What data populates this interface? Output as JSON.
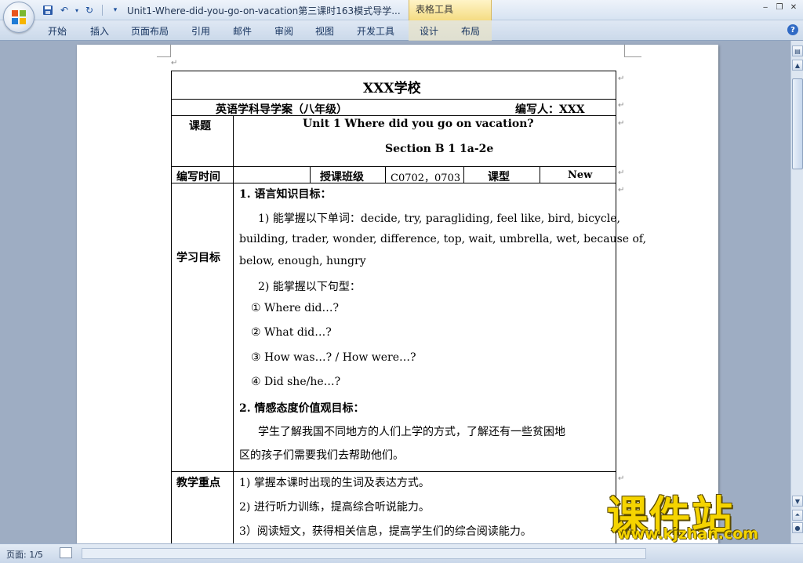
{
  "window": {
    "title": "Unit1-Where-did-you-go-on-vacation第三课时163模式导学...",
    "context_group": "表格工具"
  },
  "tabs": [
    "开始",
    "插入",
    "页面布局",
    "引用",
    "邮件",
    "审阅",
    "视图",
    "开发工具",
    "设计",
    "布局"
  ],
  "document": {
    "school": "XXX学校",
    "subject_line": "英语学科导学案（八年级）",
    "author_label": "编写人：XXX",
    "topic_label": "课题",
    "topic_title": "Unit 1 Where did you go on vacation?",
    "topic_section": "Section B 1 1a-2e",
    "row_time_label": "编写时间",
    "row_class_label": "授课班级",
    "row_class_value": "C0702，0703",
    "row_type_label": "课型",
    "row_type_value": "New",
    "goals_label": "学习目标",
    "goal1_heading": "1. 语言知识目标：",
    "goal1_words_line1": "1) 能掌握以下单词：decide, try, paragliding, feel like, bird, bicycle,",
    "goal1_words_line2": "building, trader, wonder, difference, top, wait, umbrella, wet, because of,",
    "goal1_words_line3": "below, enough, hungry",
    "goal1_sentences": "2) 能掌握以下句型：",
    "pattern1": "① Where did…?",
    "pattern2": "② What did…?",
    "pattern3": "③ How was…?   / How were…?",
    "pattern4": "④ Did she/he…?",
    "goal2_heading": "2. 情感态度价值观目标：",
    "goal2_line1": "学生了解我国不同地方的人们上学的方式，了解还有一些贫困地",
    "goal2_line2": "区的孩子们需要我们去帮助他们。",
    "key_label": "教学重点",
    "key1": "1) 掌握本课时出现的生词及表达方式。",
    "key2": "2) 进行听力训练，提高综合听说能力。",
    "key3": "3）阅读短文，获得相关信息，提高学生们的综合阅读能力。"
  },
  "status": {
    "page": "页面: 1/5"
  },
  "watermark": {
    "text": "课件站",
    "url": "www.kjzhan.com"
  },
  "colors": {
    "ribbon": "#cbd9ea",
    "context_tab": "#f4dc83",
    "watermark": "#f5d400"
  }
}
